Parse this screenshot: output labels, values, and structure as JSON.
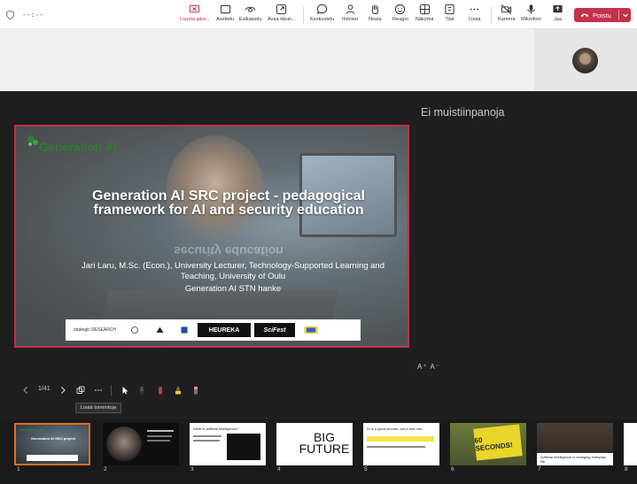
{
  "meeting": {
    "timer": "--:--",
    "toolbar": [
      {
        "key": "stop",
        "label": "Lopeta jaka...",
        "icon": "stop-share-icon"
      },
      {
        "key": "layout",
        "label": "Asettelu",
        "icon": "layout-icon"
      },
      {
        "key": "preview",
        "label": "Esikatselu",
        "icon": "eye-icon"
      },
      {
        "key": "openwin",
        "label": "Avaa ikkun...",
        "icon": "open-window-icon"
      },
      {
        "key": "chat",
        "label": "Keskustelu",
        "icon": "chat-icon"
      },
      {
        "key": "people",
        "label": "Ihmiset",
        "icon": "people-icon"
      },
      {
        "key": "raise",
        "label": "Nosta",
        "icon": "raise-hand-icon"
      },
      {
        "key": "react",
        "label": "Reagoi",
        "icon": "smiley-icon"
      },
      {
        "key": "view",
        "label": "Näkymä",
        "icon": "view-icon"
      },
      {
        "key": "rooms",
        "label": "Tilat",
        "icon": "rooms-icon"
      },
      {
        "key": "more",
        "label": "Lisää",
        "icon": "more-icon"
      },
      {
        "key": "camera",
        "label": "Kamera",
        "icon": "camera-off-icon"
      },
      {
        "key": "mic",
        "label": "Mikrofoni",
        "icon": "mic-icon"
      },
      {
        "key": "share",
        "label": "Jaa",
        "icon": "share-icon"
      }
    ],
    "leave_label": "Poistu",
    "accent": "#c4314b"
  },
  "notes": {
    "title": "Ei muistiinpanoja",
    "font_buttons": "A⁺ A⁻"
  },
  "slide": {
    "brand": "Generation AI",
    "title": "Generation AI SRC project - pedagogical framework for AI and security education",
    "mirror": "security education",
    "author": "Jari Laru, M.Sc. (Econ.), University Lecturer, Technology-Supported Learning and Teaching, University of Oulu",
    "hanke": "Generation AI STN hanke",
    "partners": [
      "strategic RESEARCH",
      "",
      "",
      "",
      "HEUREKA",
      "SciFest",
      ""
    ]
  },
  "controls": {
    "page_indicator": "1/41",
    "tooltip": "Lisää toimintoja"
  },
  "thumbnails": [
    {
      "n": "1",
      "title": "Generation AI SRC project"
    },
    {
      "n": "2",
      "title": ""
    },
    {
      "n": "3",
      "title": "What is artificial intelligence?"
    },
    {
      "n": "4",
      "title": "BIG FUTURE"
    },
    {
      "n": "5",
      "title": "AI is a good servant, but a bad one..."
    },
    {
      "n": "6",
      "title": "60 SECONDS!"
    },
    {
      "n": "7",
      "title": "Artificial intelligence is changing everyday life"
    },
    {
      "n": "8",
      "title": ""
    }
  ]
}
